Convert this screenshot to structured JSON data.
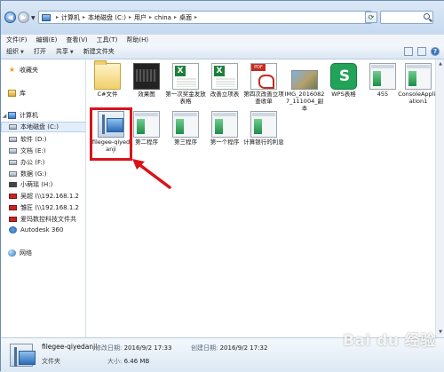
{
  "address": {
    "crumbs": [
      "计算机",
      "本地磁盘 (C:)",
      "用户",
      "china",
      "桌面"
    ]
  },
  "menu": [
    "文件(F)",
    "编辑(E)",
    "查看(V)",
    "工具(T)",
    "帮助(H)"
  ],
  "toolbar": {
    "organize": "组织",
    "open": "打开",
    "share": "共享",
    "new_folder": "新建文件夹"
  },
  "nav": {
    "favorites": "收藏夹",
    "library": "库",
    "computer": "计算机",
    "drive_c": "本地磁盘 (C:)",
    "drive_d": "软件 (D:)",
    "drive_e": "文档 (E:)",
    "drive_f": "办公 (F:)",
    "drive_g": "数据 (G:)",
    "drive_h": "小萌瑶 (H:)",
    "net1": "吴超 (\\\\192.168.1.2",
    "net2": "雏匠 (\\\\192.168.1.2",
    "net3": "爱玛数控科技文件共",
    "autodesk": "Autodesk 360",
    "network": "网络"
  },
  "files": {
    "f1": "C#文件",
    "f2": "效果图",
    "f3": "第一次奖金发放表格",
    "f4": "改善立项表",
    "f5": "第四次改善立项查收单",
    "f6": "IMG_20160827_111004_副本",
    "f7": "WPS表格",
    "f8": "455",
    "f9": "ConsoleApplication1",
    "f10": "filegee-qiyedanji",
    "f11": "第二程序",
    "f12": "第三程序",
    "f13": "第一个程序",
    "f14": "计算银行的利息"
  },
  "details": {
    "name": "filegee-qiyedanji",
    "type": "文件夹",
    "modified_label": "修改日期:",
    "modified": "2016/9/2 17:33",
    "created_label": "创建日期:",
    "created": "2016/9/2 17:32",
    "size_label": "大小:",
    "size": "6.46 MB"
  },
  "watermark": "Bai du 经验"
}
